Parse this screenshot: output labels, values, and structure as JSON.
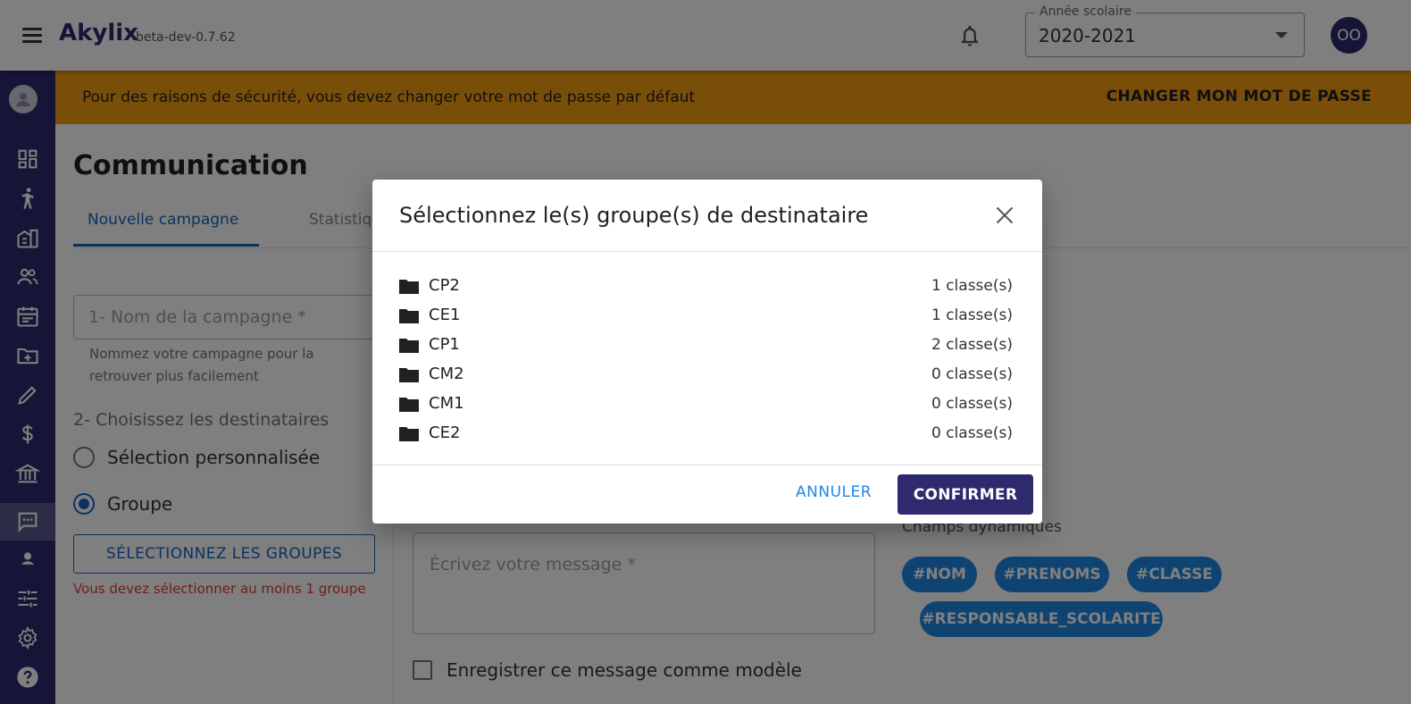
{
  "header": {
    "app_name": "Akylix",
    "version": "beta-dev-0.7.62",
    "school_year_label": "Année scolaire",
    "school_year_value": "2020-2021",
    "avatar_initials": "OO"
  },
  "banner": {
    "message": "Pour des raisons de sécurité, vous devez changer votre mot de passe par défaut",
    "action": "CHANGER MON MOT DE PASSE"
  },
  "sidebar": {
    "items": [
      {
        "icon": "profile-icon"
      },
      {
        "icon": "dashboard-icon"
      },
      {
        "icon": "student-icon"
      },
      {
        "icon": "building-icon"
      },
      {
        "icon": "people-icon"
      },
      {
        "icon": "calendar-icon"
      },
      {
        "icon": "folder-add-icon"
      },
      {
        "icon": "pencil-icon"
      },
      {
        "icon": "dollar-icon"
      },
      {
        "icon": "bank-icon"
      },
      {
        "icon": "message-icon",
        "active": true
      },
      {
        "icon": "person-icon"
      },
      {
        "icon": "sliders-icon"
      },
      {
        "icon": "gear-icon"
      },
      {
        "icon": "help-icon"
      }
    ]
  },
  "page": {
    "title": "Communication",
    "tabs": [
      {
        "label": "Nouvelle campagne",
        "active": true
      },
      {
        "label": "Statistiq"
      }
    ],
    "campaign_name_placeholder": "1- Nom de la campagne *",
    "campaign_name_helper": "Nommez votre campagne pour la retrouver plus facilement",
    "recipients_title": "2- Choisissez les destinataires",
    "radio_custom": "Sélection personnalisée",
    "radio_group": "Groupe",
    "select_groups_button": "SÉLECTIONNEZ LES GROUPES",
    "select_groups_error": "Vous devez sélectionner au moins 1 groupe",
    "message_placeholder": "Écrivez votre message *",
    "save_template_label": "Enregistrer ce message comme modèle",
    "dynamic_fields_title": "Champs dynamiques",
    "dynamic_fields": [
      "#NOM",
      "#PRENOMS",
      "#CLASSE",
      "#RESPONSABLE_SCOLARITE"
    ]
  },
  "dialog": {
    "title": "Sélectionnez le(s) groupe(s) de destinataire",
    "groups": [
      {
        "name": "CP2",
        "count": "1 classe(s)"
      },
      {
        "name": "CE1",
        "count": "1 classe(s)"
      },
      {
        "name": "CP1",
        "count": "2 classe(s)"
      },
      {
        "name": "CM2",
        "count": "0 classe(s)"
      },
      {
        "name": "CM1",
        "count": "0 classe(s)"
      },
      {
        "name": "CE2",
        "count": "0 classe(s)"
      }
    ],
    "cancel": "ANNULER",
    "confirm": "CONFIRMER"
  },
  "colors": {
    "brand": "#2d2a6e",
    "accent": "#1565c0",
    "warning": "#f29c12",
    "error": "#e53935",
    "chip": "#1e88e5"
  }
}
